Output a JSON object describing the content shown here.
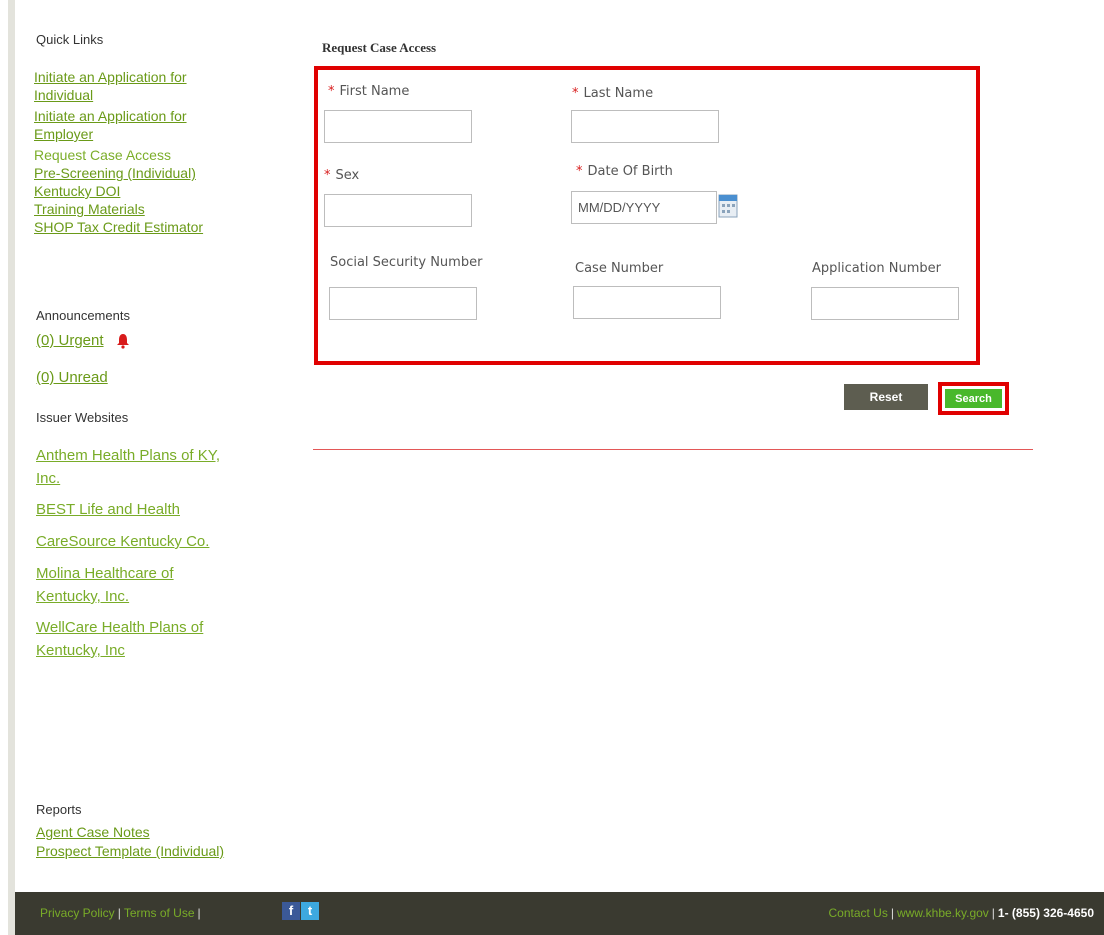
{
  "sidebar": {
    "quick_links_heading": "Quick Links",
    "quick_links": [
      "Initiate an Application for Individual",
      "Initiate an Application for Employer",
      "Request Case Access",
      "Pre-Screening (Individual)",
      "Kentucky DOI",
      "Training Materials",
      "SHOP Tax Credit Estimator"
    ],
    "announcements_heading": "Announcements",
    "urgent_label": "(0) Urgent",
    "unread_label": "(0) Unread",
    "issuer_heading": "Issuer Websites",
    "issuers": [
      "Anthem Health Plans of KY, Inc.",
      "BEST Life and Health",
      "CareSource Kentucky Co.",
      "Molina Healthcare of Kentucky, Inc.",
      "WellCare Health Plans of Kentucky, Inc"
    ],
    "reports_heading": "Reports",
    "reports": [
      "Agent Case Notes",
      "Prospect Template (Individual)"
    ]
  },
  "form": {
    "title": "Request Case Access",
    "required_marker": "*",
    "first_name_label": "First Name",
    "last_name_label": "Last Name",
    "sex_label": "Sex",
    "dob_label": "Date Of Birth",
    "dob_placeholder": "MM/DD/YYYY",
    "ssn_label": "Social Security Number",
    "case_number_label": "Case Number",
    "application_number_label": "Application Number",
    "reset_label": "Reset",
    "search_label": "Search"
  },
  "footer": {
    "privacy": "Privacy Policy",
    "terms": "Terms of Use",
    "separator": "|",
    "facebook_glyph": "f",
    "twitter_glyph": "t",
    "contact": "Contact Us",
    "website": "www.khbe.ky.gov",
    "phone": "1- (855) 326-4650"
  },
  "colors": {
    "link_green": "#6a9a18",
    "highlight_red": "#e00000",
    "search_green": "#49b82b",
    "reset_gray": "#5d5d50",
    "footer_bg": "#3a3a30"
  },
  "icons": [
    "bell-icon",
    "calendar-icon",
    "facebook-icon",
    "twitter-icon"
  ]
}
